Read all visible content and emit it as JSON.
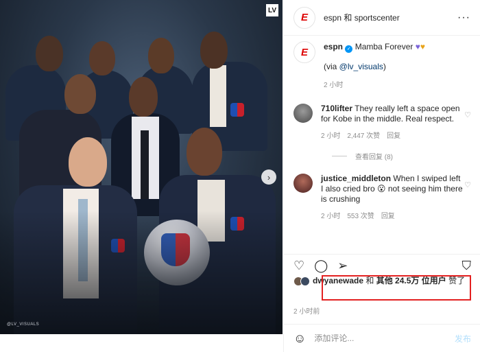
{
  "header": {
    "account": "espn 和 sportscenter",
    "more_icon": "more-icon"
  },
  "caption": {
    "user": "espn",
    "text": "Mamba Forever",
    "via_prefix": "(via ",
    "via_link": "@lv_visuals",
    "via_suffix": ")",
    "time": "2 小时"
  },
  "comments": [
    {
      "user": "710lifter",
      "text": "They really left a space open for Kobe in the middle. Real respect.",
      "time": "2 小时",
      "likes": "2,447 次赞",
      "reply": "回复",
      "avatar_color": "#6b6b6b"
    },
    {
      "user": "justice_middleton",
      "text": "When I swiped left I also cried bro 😮 not seeing him there is crushing",
      "time": "2 小时",
      "likes": "553 次赞",
      "reply": "回复",
      "avatar_color": "#7a3b3b"
    }
  ],
  "view_replies": "查看回复 (8)",
  "likes": {
    "user": "dwyanewade",
    "text_mid": " 和 ",
    "others": "其他 24.5万 位用户",
    "text_end": " 赞了"
  },
  "post_time": "2 小时前",
  "add_comment": {
    "placeholder": "添加评论...",
    "post_label": "发布"
  },
  "image": {
    "logo_text": "LV",
    "watermark": "@LV_VISUALS"
  },
  "colors": {
    "accent": "#0095f6",
    "highlight": "#e32020",
    "espn_red": "#dd0000"
  }
}
